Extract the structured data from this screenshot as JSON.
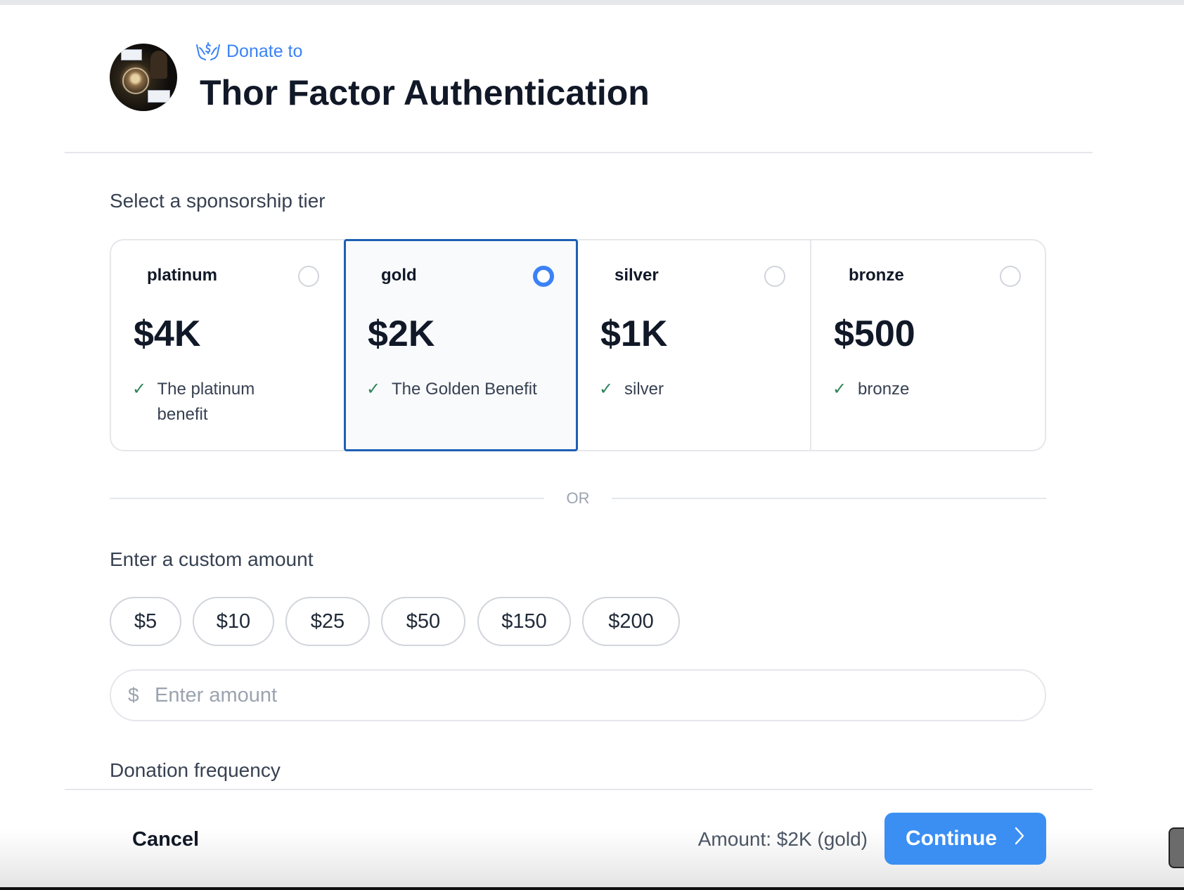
{
  "header": {
    "donate_to_label": "Donate to",
    "project_title": "Thor Factor Authentication",
    "donate_icon": "hand-dollar-icon"
  },
  "tiers": {
    "section_label": "Select a sponsorship tier",
    "items": [
      {
        "name": "platinum",
        "price": "$4K",
        "benefit": "The platinum benefit",
        "selected": false
      },
      {
        "name": "gold",
        "price": "$2K",
        "benefit": "The Golden Benefit",
        "selected": true
      },
      {
        "name": "silver",
        "price": "$1K",
        "benefit": "silver",
        "selected": false
      },
      {
        "name": "bronze",
        "price": "$500",
        "benefit": "bronze",
        "selected": false
      }
    ]
  },
  "or_label": "OR",
  "custom_amount": {
    "section_label": "Enter a custom amount",
    "presets": [
      "$5",
      "$10",
      "$25",
      "$50",
      "$150",
      "$200"
    ],
    "currency_symbol": "$",
    "input_value": "",
    "placeholder": "Enter amount"
  },
  "frequency": {
    "section_label": "Donation frequency"
  },
  "footer": {
    "cancel_label": "Cancel",
    "amount_summary": "Amount: $2K (gold)",
    "continue_label": "Continue",
    "continue_icon": "chevron-right-icon"
  },
  "colors": {
    "accent": "#3b82f6",
    "selected_border": "#1e5fb4",
    "check_green": "#2f855a",
    "continue_bg": "#3b8ff3"
  }
}
